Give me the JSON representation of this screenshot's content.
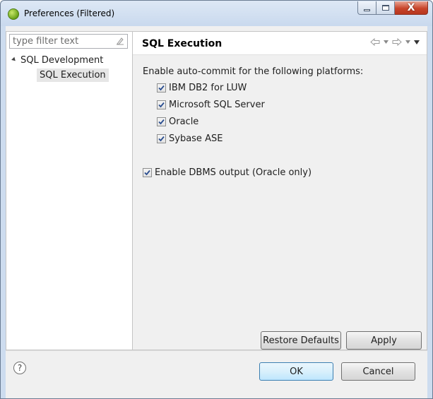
{
  "window": {
    "title": "Preferences (Filtered)",
    "minimize_glyph": "",
    "close_glyph": "X"
  },
  "filter": {
    "placeholder": "type filter text"
  },
  "tree": {
    "items": [
      {
        "label": "SQL Development",
        "expanded": true
      },
      {
        "label": "SQL Execution",
        "selected": true
      }
    ]
  },
  "page": {
    "title": "SQL Execution",
    "auto_commit_label": "Enable auto-commit for the following platforms:",
    "platforms": [
      {
        "label": "IBM DB2 for LUW",
        "checked": true
      },
      {
        "label": "Microsoft SQL Server",
        "checked": true
      },
      {
        "label": "Oracle",
        "checked": true
      },
      {
        "label": "Sybase ASE",
        "checked": true
      }
    ],
    "dbms_output": {
      "label": "Enable DBMS output (Oracle only)",
      "checked": true
    }
  },
  "buttons": {
    "restore_defaults": "Restore Defaults",
    "apply": "Apply",
    "ok": "OK",
    "cancel": "Cancel"
  },
  "help": {
    "glyph": "?"
  },
  "icons": {
    "app": "eclipse-green-icon",
    "back": "back-arrow-icon",
    "forward": "forward-arrow-icon",
    "menu": "view-menu-icon",
    "clear_filter": "clear-filter-icon",
    "help": "help-icon"
  },
  "colors": {
    "window_frame": "#cddcef",
    "close_button": "#c8452b",
    "selection": "#e6e6e6",
    "ok_border": "#3c7fb1"
  }
}
